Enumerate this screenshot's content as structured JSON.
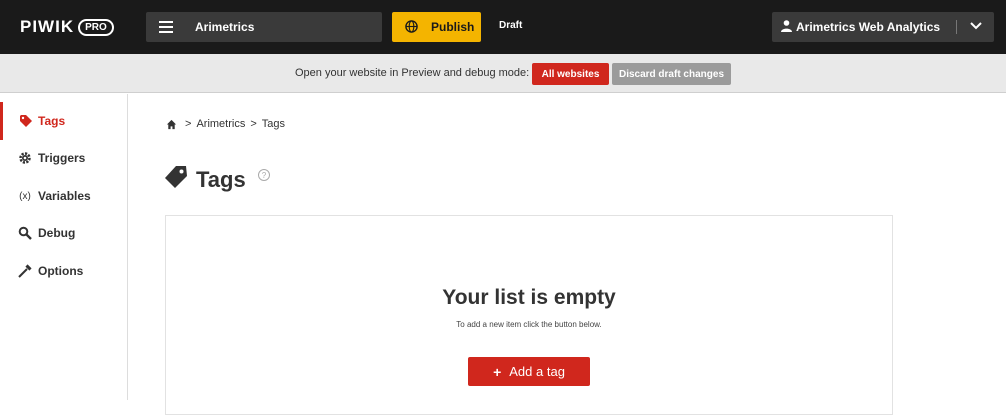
{
  "topbar": {
    "logo_text": "PIWIK",
    "logo_badge": "PRO",
    "site_selector": {
      "label": "Arimetrics",
      "icon": "menu-icon"
    },
    "publish_label": "Publish",
    "draft_label": "Draft",
    "account_selector": {
      "label": "Arimetrics Web Analytics",
      "icon": "user-icon"
    },
    "accent_color": "#f4b400"
  },
  "preview_bar": {
    "text": "Open your website in Preview and debug mode:",
    "all_websites_label": "All websites",
    "discard_label": "Discard draft changes"
  },
  "sidebar": {
    "items": [
      {
        "label": "Tags",
        "icon": "tag-icon",
        "active": true
      },
      {
        "label": "Triggers",
        "icon": "gear-icon",
        "active": false
      },
      {
        "label": "Variables",
        "icon": "variable-icon",
        "active": false
      },
      {
        "label": "Debug",
        "icon": "search-icon",
        "active": false
      },
      {
        "label": "Options",
        "icon": "wrench-icon",
        "active": false
      }
    ]
  },
  "breadcrumb": {
    "items": [
      "Arimetrics",
      "Tags"
    ],
    "separator": ">"
  },
  "main": {
    "title": "Tags",
    "help_icon": "?",
    "empty": {
      "title": "Your list is empty",
      "subtitle": "To add a new item click the button below.",
      "button_label": "Add a tag",
      "button_icon": "+"
    }
  },
  "colors": {
    "brand_red": "#d0271d",
    "topbar_bg": "#1a1a1a",
    "discard_gray": "#9b9b9b"
  }
}
